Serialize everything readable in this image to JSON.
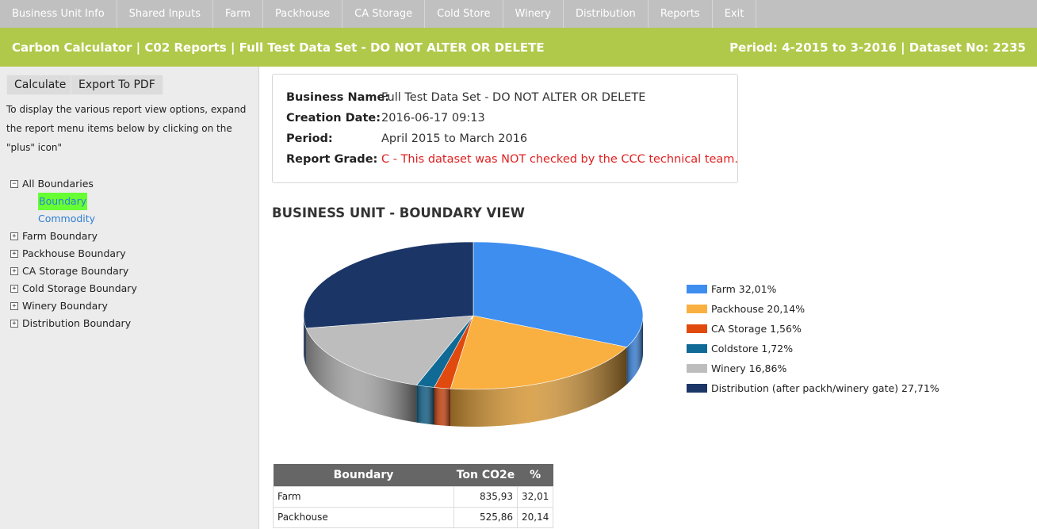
{
  "nav": [
    "Business Unit Info",
    "Shared Inputs",
    "Farm",
    "Packhouse",
    "CA Storage",
    "Cold Store",
    "Winery",
    "Distribution",
    "Reports",
    "Exit"
  ],
  "header": {
    "title": "Carbon Calculator | C02 Reports | Full Test Data Set - DO NOT ALTER OR DELETE",
    "period": "Period: 4-2015 to 3-2016 | Dataset No: 2235"
  },
  "sidebar": {
    "calculate_label": "Calculate",
    "export_label": "Export To PDF",
    "help_text": "To display the various report view options, expand the report menu items below by clicking on the \"plus\" icon\"",
    "tree": {
      "root": "All Boundaries",
      "children": [
        "Boundary",
        "Commodity"
      ],
      "groups": [
        "Farm Boundary",
        "Packhouse Boundary",
        "CA Storage Boundary",
        "Cold Storage Boundary",
        "Winery Boundary",
        "Distribution Boundary"
      ]
    }
  },
  "info": {
    "business_name_label": "Business Name:",
    "business_name": "Full Test Data Set - DO NOT ALTER OR DELETE",
    "creation_date_label": "Creation Date:",
    "creation_date": "2016-06-17 09:13",
    "period_label": "Period:",
    "period": "April 2015 to March 2016",
    "grade_label": "Report Grade:",
    "grade": "C - This dataset was NOT checked by the CCC technical team."
  },
  "section_title": "BUSINESS UNIT - BOUNDARY VIEW",
  "chart_data": {
    "type": "pie",
    "title": "",
    "categories": [
      "Farm",
      "Packhouse",
      "CA Storage",
      "Coldstore",
      "Winery",
      "Distribution (after packh/winery gate)"
    ],
    "values": [
      32.01,
      20.14,
      1.56,
      1.72,
      16.86,
      27.71
    ],
    "legend_labels": [
      "Farm 32,01%",
      "Packhouse 20,14%",
      "CA Storage 1,56%",
      "Coldstore 1,72%",
      "Winery 16,86%",
      "Distribution (after packh/winery gate) 27,71%"
    ],
    "colors": [
      "#3e8ef0",
      "#f9b040",
      "#e04a0e",
      "#106a96",
      "#bdbdbd",
      "#1b3666"
    ],
    "legend_position": "right"
  },
  "table": {
    "headers": [
      "Boundary",
      "Ton CO2e",
      "%"
    ],
    "rows": [
      [
        "Farm",
        "835,93",
        "32,01"
      ],
      [
        "Packhouse",
        "525,86",
        "20,14"
      ]
    ]
  }
}
